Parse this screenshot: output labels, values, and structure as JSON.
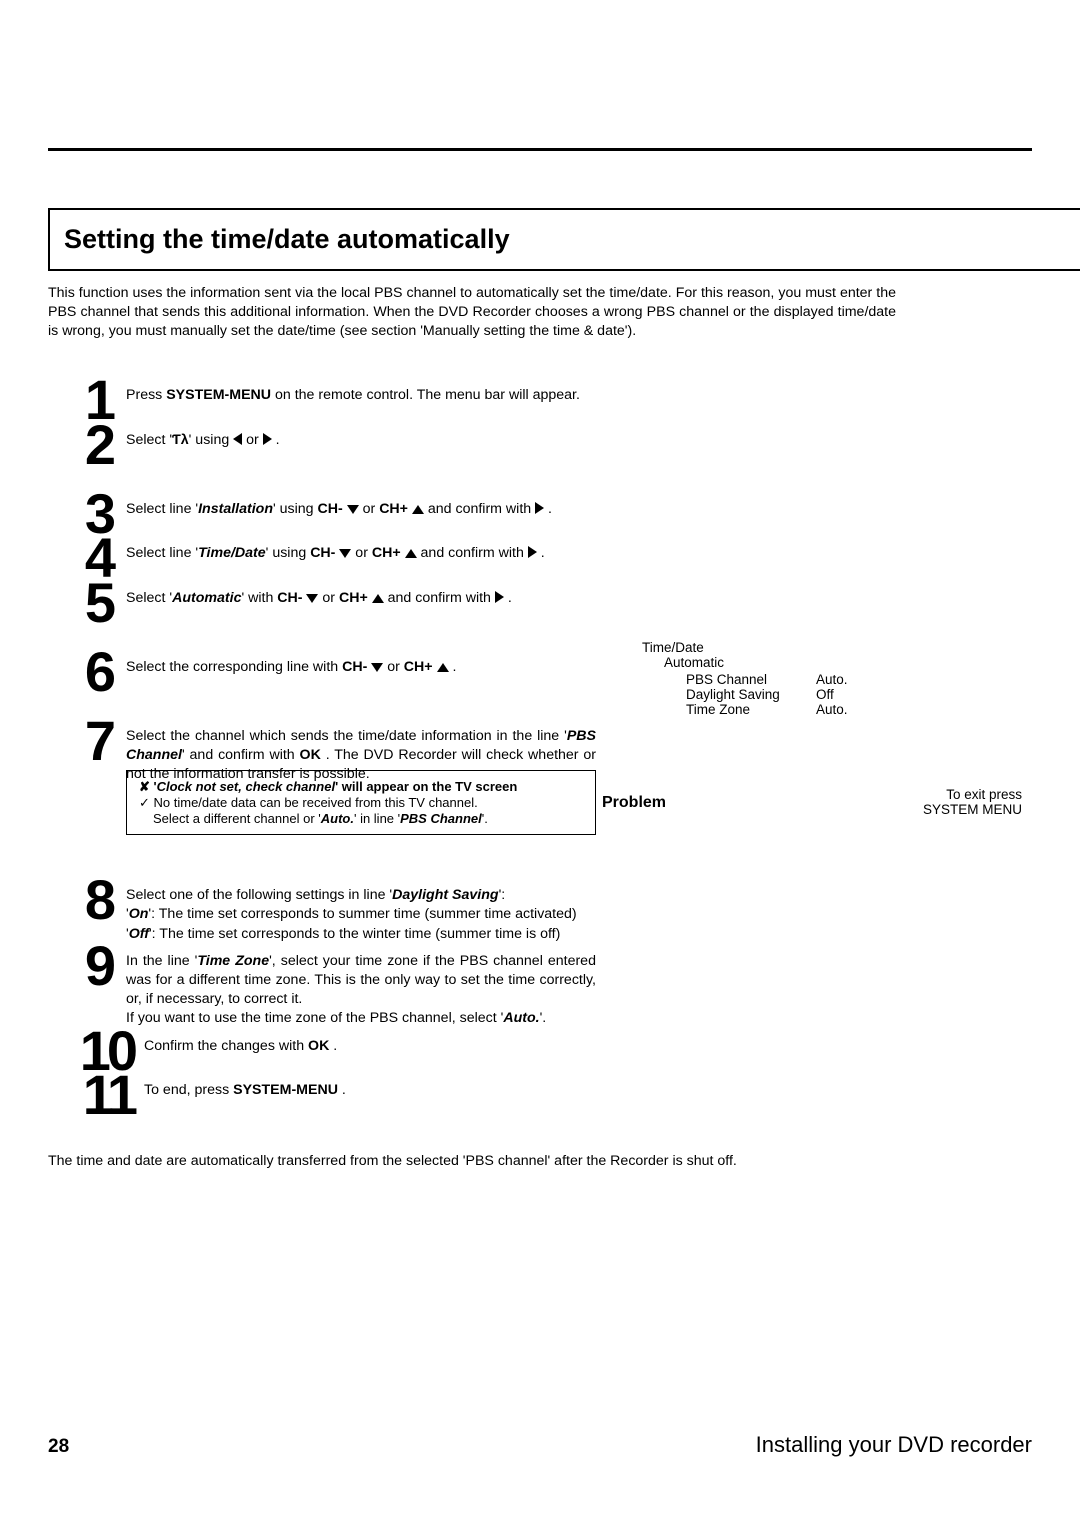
{
  "heading": "Setting the time/date automatically",
  "intro": "This function uses the information sent via the local PBS channel to automatically set the time/date. For this reason, you must enter the PBS channel that sends this additional information. When the DVD Recorder chooses a wrong PBS channel or the displayed time/date is wrong, you must manually set the date/time (see section 'Manually setting the time & date').",
  "steps": {
    "s1a": "Press ",
    "s1b": "SYSTEM-MENU",
    "s1c": " on the remote control. The menu bar will appear.",
    "s2a": "Select '",
    "s2b": "' using ",
    "s3a": "Select line '",
    "s3b": "Installation",
    "s3c": "' using ",
    "s3d": "CH-",
    "s3e": " or ",
    "s3f": "CH+",
    "s3g": " and confirm with ",
    "s4a": "Select line '",
    "s4b": "Time/Date",
    "s4c": "' using ",
    "s5a": "Select '",
    "s5b": "Automatic",
    "s5c": "' with ",
    "s5d": " and confirm with ",
    "s6a": "Select the corresponding line with ",
    "s7a": "Select the channel which sends the time/date information in the line '",
    "s7b": "PBS Channel",
    "s7c": "' and confirm with ",
    "s7d": "OK",
    "s7e": " . The DVD Recorder will check whether or not the information transfer is possible.",
    "s8a": "Select one of the following settings in line '",
    "s8b": "Daylight Saving",
    "s8c": "':",
    "s8d": "'",
    "s8e": "On",
    "s8f": "': The time set corresponds to summer time (summer time activated)",
    "s8g": "'",
    "s8h": "Off",
    "s8i": "': The time set corresponds to the winter time (summer time is off)",
    "s9a": "In the line '",
    "s9b": "Time Zone",
    "s9c": "', select your time zone if the PBS channel entered was for a different time zone. This is the only way to set the time correctly, or, if necessary, to correct it.",
    "s9d": "If you want to use the time zone of the PBS channel, select '",
    "s9e": "Auto.",
    "s9f": "'.",
    "s10a": "Confirm the changes with ",
    "s10b": "OK",
    "s10c": " .",
    "s11a": "To end, press ",
    "s11b": "SYSTEM-MENU",
    "s11c": " ."
  },
  "problem": {
    "title_a": "'",
    "title_b": "Clock not set, check channel",
    "title_c": "' will appear on the TV screen",
    "line1": "No time/date data can be received from this TV channel.",
    "line2a": "Select a different channel or '",
    "line2b": "Auto.",
    "line2c": "' in line '",
    "line2d": "PBS Channel",
    "line2e": "'.",
    "label": "Problem"
  },
  "sidepanel": {
    "title": "Time/Date",
    "sub": "Automatic",
    "rows": [
      {
        "label": "PBS Channel",
        "value": "Auto."
      },
      {
        "label": "Daylight Saving",
        "value": "Off"
      },
      {
        "label": "Time Zone",
        "value": "Auto."
      }
    ],
    "exit1": "To exit press",
    "exit2": "SYSTEM MENU"
  },
  "footer": "The time and date are automatically transferred from the selected 'PBS channel' after the Recorder is shut off.",
  "page_number": "28",
  "section": "Installing your DVD recorder",
  "nums": {
    "n1": "1",
    "n2": "2",
    "n3": "3",
    "n4": "4",
    "n5": "5",
    "n6": "6",
    "n7": "7",
    "n8": "8",
    "n9": "9",
    "n10": "10",
    "n11": "11"
  },
  "misc": {
    "dot": " .",
    "or": " or "
  }
}
